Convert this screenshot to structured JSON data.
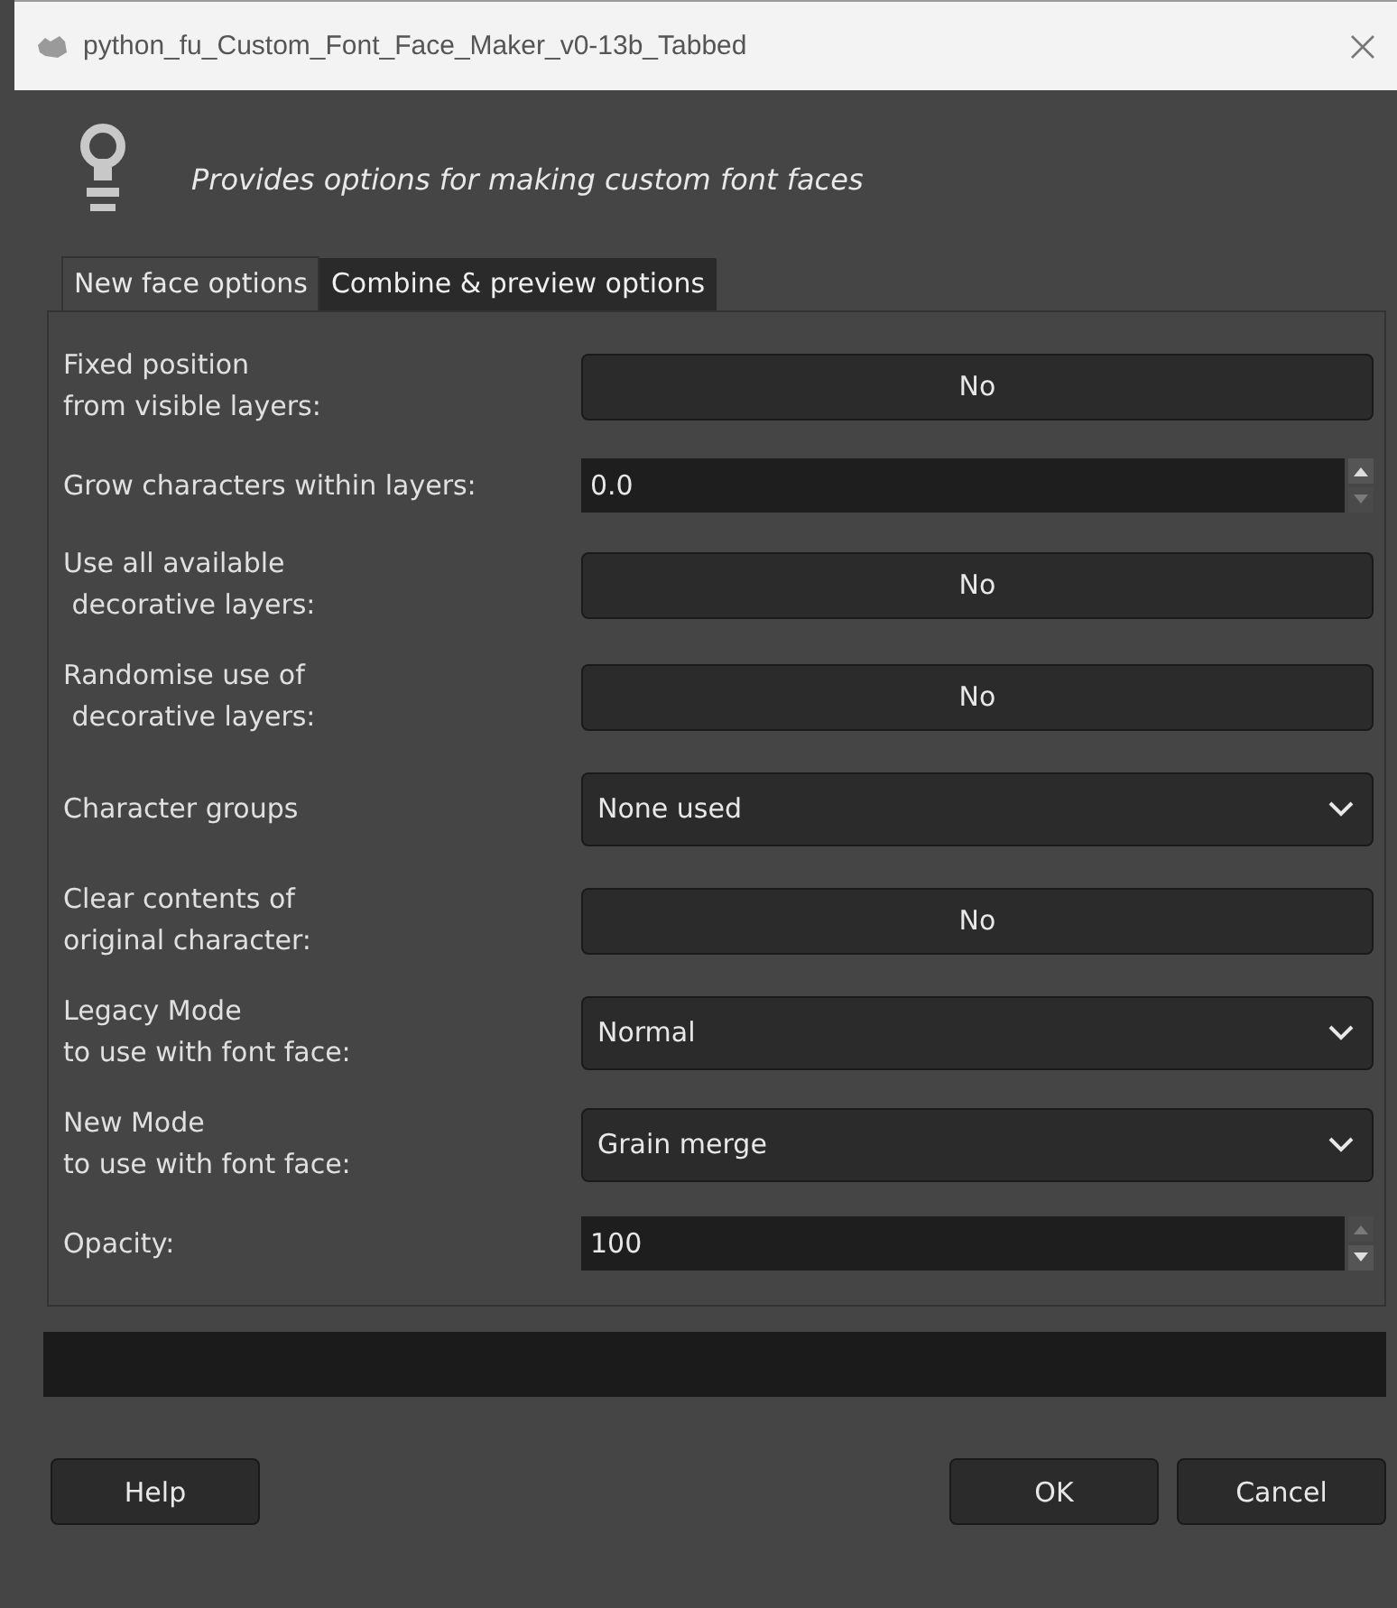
{
  "window": {
    "title": "python_fu_Custom_Font_Face_Maker_v0-13b_Tabbed"
  },
  "description": "Provides options for making custom font faces",
  "tabs": [
    {
      "label": "New face options",
      "selected": true
    },
    {
      "label": "Combine & preview options",
      "selected": false
    }
  ],
  "options": [
    {
      "kind": "toggle",
      "label": "Fixed position\nfrom visible layers:",
      "value": "No"
    },
    {
      "kind": "spin",
      "label": "Grow characters within layers:",
      "value": "0.0",
      "up_disabled": false,
      "down_disabled": true
    },
    {
      "kind": "toggle",
      "label": "Use all available\n decorative layers:",
      "value": "No"
    },
    {
      "kind": "toggle",
      "label": "Randomise use of\n decorative layers:",
      "value": "No"
    },
    {
      "kind": "combo",
      "label": "Character groups",
      "value": "None used"
    },
    {
      "kind": "toggle",
      "label": "Clear contents of\noriginal character:",
      "value": "No"
    },
    {
      "kind": "combo",
      "label": "Legacy Mode\nto use with font face:",
      "value": "Normal"
    },
    {
      "kind": "combo",
      "label": "New Mode\nto use with font face:",
      "value": "Grain merge"
    },
    {
      "kind": "spin",
      "label": "Opacity:",
      "value": "100",
      "up_disabled": true,
      "down_disabled": false
    }
  ],
  "buttons": [
    {
      "label": "Help",
      "kind": "left"
    },
    {
      "label": "OK",
      "kind": "right"
    },
    {
      "label": "Cancel",
      "kind": "right"
    }
  ]
}
